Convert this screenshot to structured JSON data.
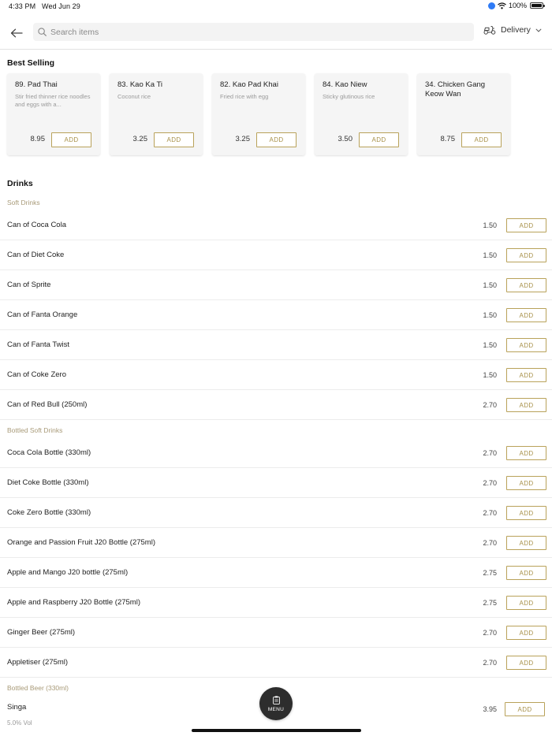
{
  "status_bar": {
    "time": "4:33 PM",
    "date": "Wed Jun 29",
    "battery": "100%",
    "icons": [
      "location-icon",
      "wifi-icon",
      "battery-icon"
    ]
  },
  "header": {
    "back_icon": "back-arrow-icon",
    "search_placeholder": "Search items",
    "search_value": "",
    "delivery_label": "Delivery",
    "delivery_icon": "scooter-icon"
  },
  "best_selling": {
    "title": "Best Selling",
    "cards": [
      {
        "name": "89. Pad Thai",
        "desc": "Stir fried thinner rice noodles and eggs with a...",
        "price": "8.95",
        "add": "ADD"
      },
      {
        "name": "83. Kao Ka Ti",
        "desc": "Coconut rice",
        "price": "3.25",
        "add": "ADD"
      },
      {
        "name": "82. Kao Pad Khai",
        "desc": "Fried rice with egg",
        "price": "3.25",
        "add": "ADD"
      },
      {
        "name": "84. Kao Niew",
        "desc": "Sticky glutinous rice",
        "price": "3.50",
        "add": "ADD"
      },
      {
        "name": "34. Chicken Gang Keow Wan",
        "desc": "",
        "price": "8.75",
        "add": "ADD"
      }
    ]
  },
  "drinks": {
    "title": "Drinks",
    "categories": [
      {
        "label": "Soft Drinks",
        "items": [
          {
            "name": "Can of Coca Cola",
            "price": "1.50",
            "add": "ADD"
          },
          {
            "name": "Can of Diet Coke",
            "price": "1.50",
            "add": "ADD"
          },
          {
            "name": "Can of Sprite",
            "price": "1.50",
            "add": "ADD"
          },
          {
            "name": "Can of Fanta Orange",
            "price": "1.50",
            "add": "ADD"
          },
          {
            "name": "Can of Fanta Twist",
            "price": "1.50",
            "add": "ADD"
          },
          {
            "name": "Can of Coke Zero",
            "price": "1.50",
            "add": "ADD"
          },
          {
            "name": "Can of Red Bull (250ml)",
            "price": "2.70",
            "add": "ADD"
          }
        ]
      },
      {
        "label": "Bottled Soft Drinks",
        "items": [
          {
            "name": "Coca Cola Bottle (330ml)",
            "price": "2.70",
            "add": "ADD"
          },
          {
            "name": "Diet Coke Bottle (330ml)",
            "price": "2.70",
            "add": "ADD"
          },
          {
            "name": "Coke Zero Bottle (330ml)",
            "price": "2.70",
            "add": "ADD"
          },
          {
            "name": "Orange and Passion Fruit J20 Bottle (275ml)",
            "price": "2.70",
            "add": "ADD"
          },
          {
            "name": "Apple and Mango J20 bottle (275ml)",
            "price": "2.75",
            "add": "ADD"
          },
          {
            "name": "Apple and Raspberry J20 Bottle (275ml)",
            "price": "2.75",
            "add": "ADD"
          },
          {
            "name": "Ginger Beer (275ml)",
            "price": "2.70",
            "add": "ADD"
          },
          {
            "name": "Appletiser (275ml)",
            "price": "2.70",
            "add": "ADD"
          }
        ]
      },
      {
        "label": "Bottled Beer (330ml)",
        "items": [
          {
            "name": "Singa",
            "sub": "5.0% Vol",
            "price": "3.95",
            "add": "ADD"
          }
        ]
      }
    ]
  },
  "menu_button": {
    "label": "MENU",
    "icon": "clipboard-icon"
  }
}
